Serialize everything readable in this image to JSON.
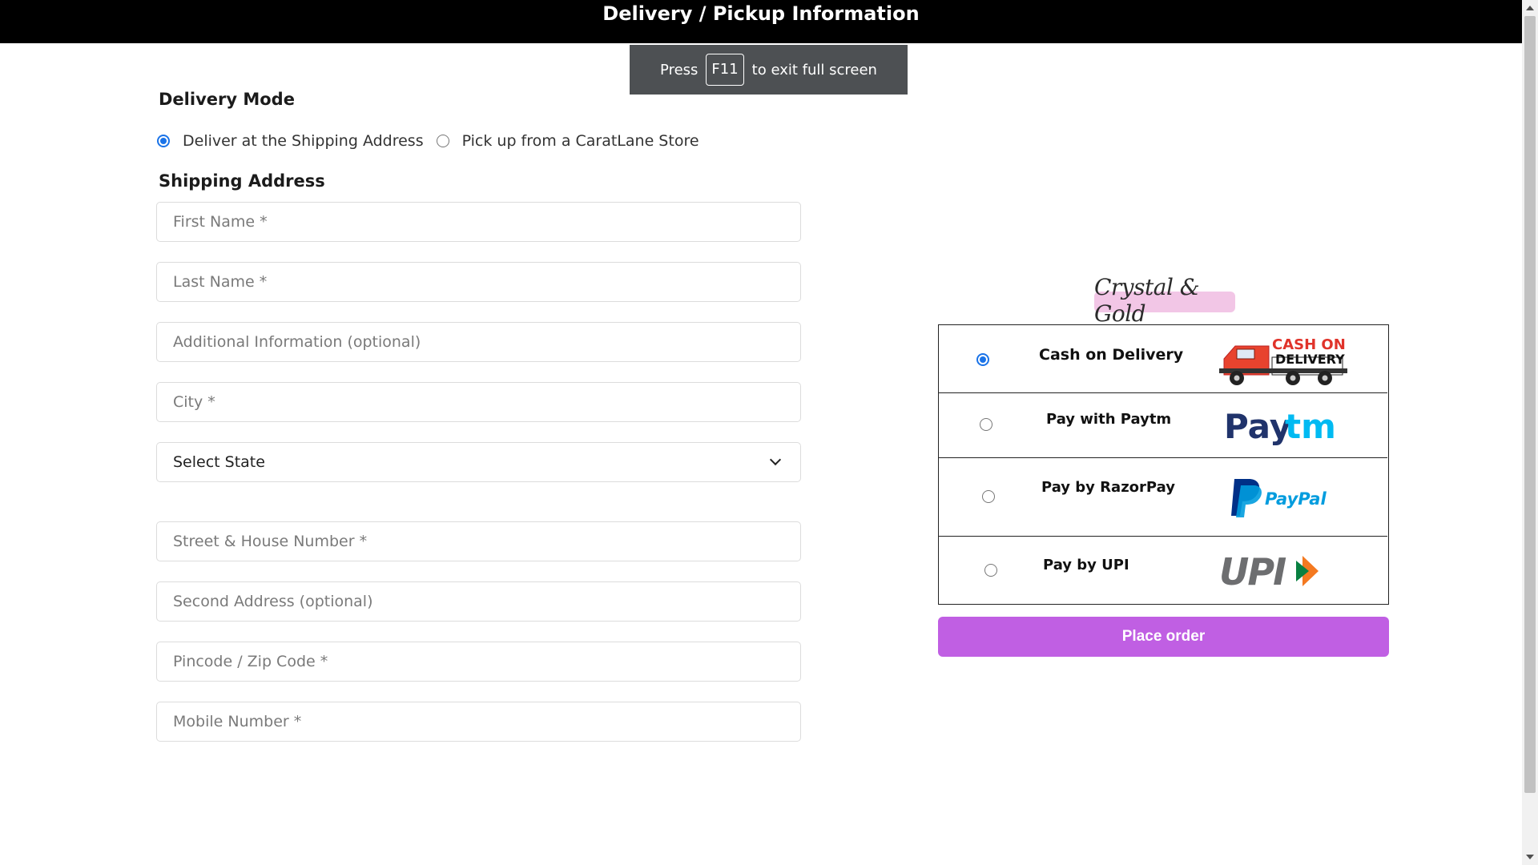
{
  "header": {
    "title": "Delivery / Pickup Information"
  },
  "toast": {
    "press": "Press",
    "key": "F11",
    "suffix": "to exit full screen"
  },
  "delivery_mode": {
    "title": "Delivery Mode",
    "options": [
      {
        "label": "Deliver at the Shipping Address",
        "selected": true
      },
      {
        "label": "Pick up from a CaratLane Store",
        "selected": false
      }
    ]
  },
  "shipping": {
    "title": "Shipping Address",
    "fields": {
      "first_name": "First Name *",
      "last_name": "Last Name *",
      "additional_info": "Additional Information (optional)",
      "city": "City *",
      "state": "Select State",
      "street": "Street & House Number *",
      "second_address": "Second Address (optional)",
      "pincode": "Pincode / Zip Code *",
      "mobile": "Mobile Number *"
    }
  },
  "brand": {
    "name": "Crystal & Gold"
  },
  "payment": {
    "options": [
      {
        "label": "Cash on Delivery",
        "selected": true,
        "logo": "cash-on-delivery-truck",
        "logo_text": [
          "CASH ON",
          "DELIVERY"
        ]
      },
      {
        "label": "Pay with Paytm",
        "selected": false,
        "logo": "paytm",
        "logo_text": [
          "Pay",
          "tm"
        ]
      },
      {
        "label": "Pay by RazorPay",
        "selected": false,
        "logo": "paypal",
        "logo_text": [
          "PayPal"
        ]
      },
      {
        "label": "Pay by UPI",
        "selected": false,
        "logo": "upi",
        "logo_text": [
          "UPI"
        ]
      }
    ],
    "submit_label": "Place order"
  },
  "colors": {
    "header_bg": "#000000",
    "accent_purple": "#c05fe3",
    "radio_blue": "#1a73e8",
    "brand_highlight": "#f2c6e6"
  }
}
